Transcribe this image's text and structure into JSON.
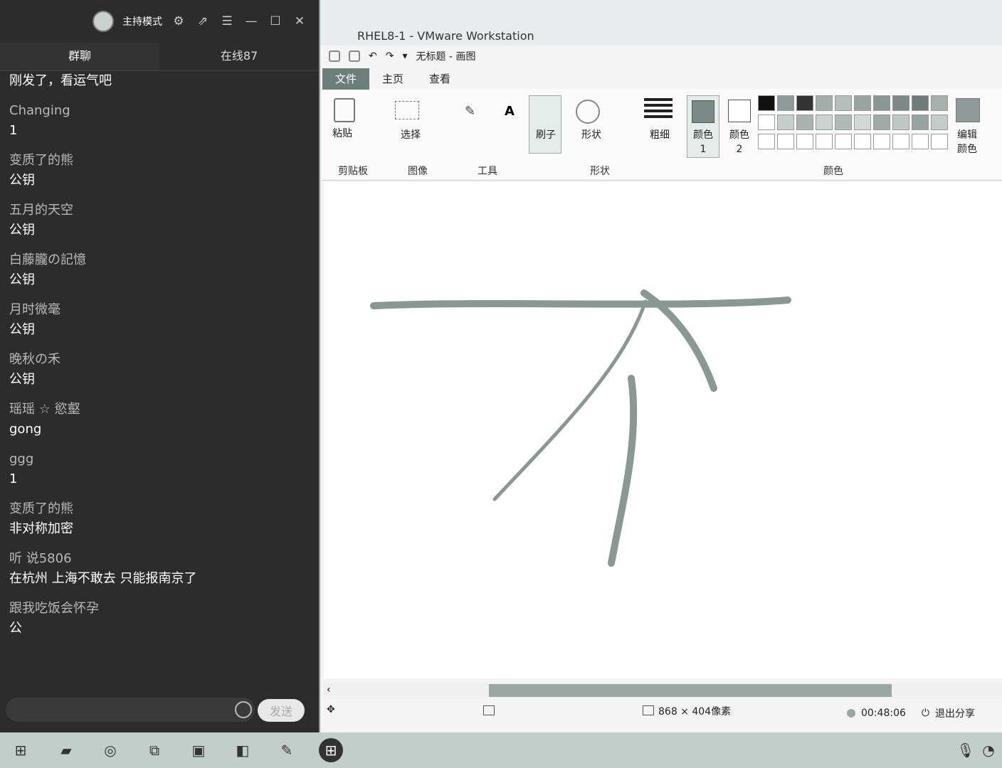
{
  "chat": {
    "host_mode": "主持模式",
    "tabs": {
      "group": "群聊",
      "online": "在线87"
    },
    "messages": [
      {
        "name": "",
        "text": "刚发了，看运气吧"
      },
      {
        "name": "Changing",
        "text": "1"
      },
      {
        "name": "变质了的熊",
        "text": "公钥"
      },
      {
        "name": "五月的天空",
        "text": "公钥"
      },
      {
        "name": "白藤朧の記憶",
        "text": "公钥"
      },
      {
        "name": "月时微毫",
        "text": "公钥"
      },
      {
        "name": "晚秋の禾",
        "text": "公钥"
      },
      {
        "name": "瑶瑶 ☆ 慾壑",
        "text": "gong"
      },
      {
        "name": "ggg",
        "text": "1"
      },
      {
        "name": "变质了的熊",
        "text": "非对称加密"
      },
      {
        "name": "听 说5806",
        "text": "在杭州  上海不敢去 只能报南京了"
      },
      {
        "name": "跟我吃饭会怀孕",
        "text": "公"
      }
    ],
    "send_label": "发送"
  },
  "vm": {
    "window_title": "RHEL8-1 - VMware Workstation",
    "paint_title": "无标题 - 画图",
    "tabs": {
      "file": "文件",
      "home": "主页",
      "view": "查看"
    },
    "ribbon": {
      "paste": "粘贴",
      "select": "选择",
      "brush": "刷子",
      "shapes": "形状",
      "size": "粗细",
      "color1": "颜色 1",
      "color2": "颜色 2",
      "edit_colors": "编辑颜色",
      "groups": {
        "clipboard": "剪贴板",
        "image": "图像",
        "tools": "工具",
        "shapes": "形状",
        "colors": "颜色"
      }
    },
    "status": {
      "dimensions": "868 × 404像素"
    },
    "share": {
      "timer": "00:48:06",
      "exit": "退出分享"
    }
  }
}
